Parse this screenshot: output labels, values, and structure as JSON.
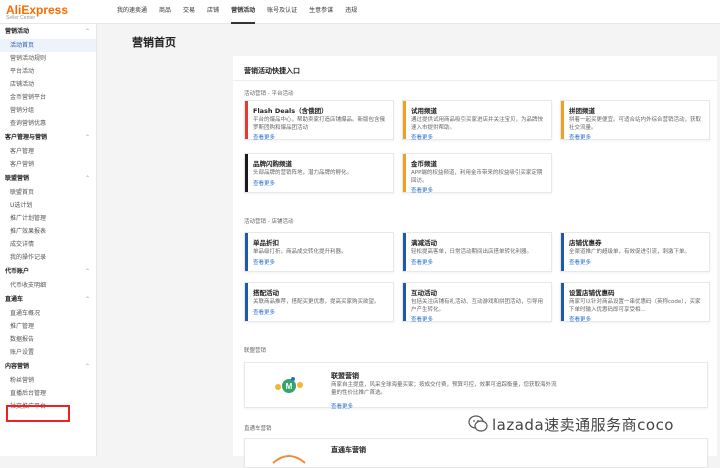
{
  "brand": {
    "logo": "AliExpress",
    "logo_sub": "Seller Center"
  },
  "topnav": [
    "我的速卖通",
    "商品",
    "交易",
    "店铺",
    "营销活动",
    "账号及认证",
    "生意参谋",
    "违规"
  ],
  "topnav_active": "营销活动",
  "sidebar": {
    "groups": [
      {
        "title": "营销活动",
        "items": [
          "活动首页",
          "营销活动规则",
          "平台活动",
          "店铺活动",
          "金币营销平台",
          "营销分组",
          "查询营销优惠"
        ]
      },
      {
        "title": "客户管理与营销",
        "items": [
          "客户管理",
          "客户营销"
        ]
      },
      {
        "title": "联盟营销",
        "items": [
          "联盟首页",
          "U选计划",
          "推广计划管理",
          "推广效果报表",
          "成交详情",
          "我的操作记录"
        ]
      },
      {
        "title": "代币账户",
        "items": [
          "代币收支明细"
        ]
      },
      {
        "title": "直通车",
        "items": [
          "直通车概况",
          "推广管理",
          "数据报告",
          "账户设置"
        ]
      },
      {
        "title": "内容营销",
        "items": [
          "粉丝营销",
          "直播后台管理",
          "社交推广平台"
        ]
      }
    ],
    "active_item": "活动首页"
  },
  "page": {
    "title": "营销首页",
    "panel_title": "营销活动快捷入口",
    "platform_label": "活动营销 - 平台活动",
    "store_label": "活动营销 - 店铺活动",
    "affiliate_label": "联盟营销",
    "ztc_label": "直通车营销"
  },
  "platform_cards": [
    {
      "title": "Flash Deals（含俄团）",
      "desc": "平台的爆品中心，帮助卖家打造店铺爆品。新版包含俄罗斯团购和爆品团活动",
      "link": "查看更多",
      "color": "#e03c31"
    },
    {
      "title": "试用频道",
      "desc": "通过提供试用商品吸引买家进店并关注宝贝，为品牌快速入市提供帮助。",
      "link": "查看更多",
      "color": "#f0a020"
    },
    {
      "title": "拼团频道",
      "desc": "拼着一起买更便宜。可适合站内外综合营销活动，获取社交流量。",
      "link": "查看更多",
      "color": "#f0a020"
    },
    {
      "title": "品牌闪购频道",
      "desc": "头部品牌的营销阵地，潜力品牌的孵化。",
      "link": "查看更多",
      "color": "#1a1a1a"
    },
    {
      "title": "金币频道",
      "desc": "APP端的权益频道，利用金币带来的权益吸引买家定期回访。",
      "link": "查看更多",
      "color": "#f0a020"
    }
  ],
  "store_cards": [
    {
      "title": "单品折扣",
      "desc": "单品级打折，商品成交转化提升利器。",
      "link": "查看更多",
      "color": "#1f5aa6"
    },
    {
      "title": "满减活动",
      "desc": "轻松提高客单，日常活动期间出店搭单转化利器。",
      "link": "查看更多",
      "color": "#1f5aa6"
    },
    {
      "title": "店铺优惠券",
      "desc": "全渠道推广的超级单，有效促进引流，刺激下单。",
      "link": "查看更多",
      "color": "#1f5aa6"
    },
    {
      "title": "搭配活动",
      "desc": "关联商品推荐，搭配买更优惠，提高买家购买欲望。",
      "link": "查看更多",
      "color": "#1f5aa6"
    },
    {
      "title": "互动活动",
      "desc": "包括关注店铺有礼活动、互动游戏和拼团活动，引导用户产生转化。",
      "link": "查看更多",
      "color": "#1f5aa6"
    },
    {
      "title": "设置店铺优惠码",
      "desc": "商家可以针对商品设置一串优惠码（英称code），买家下单时输入优惠码即可享受相...",
      "link": "查看更多",
      "color": "#1f5aa6"
    }
  ],
  "affiliate_card": {
    "title": "联盟营销",
    "desc": "商家自主提盘，风采全球海量买家；按成交付费，预算可控，效果可追踪衡量，您获取海外流量的性价比推广首选。",
    "link": "查看更多"
  },
  "ztc_card": {
    "title": "直通车营销"
  },
  "watermark": "lazada速卖通服务商coco",
  "colors": {
    "accent": "#ff6a00",
    "link": "#2a6fd6",
    "highlight": "#ee2222"
  }
}
